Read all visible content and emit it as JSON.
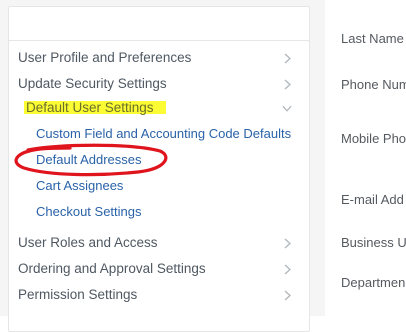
{
  "sidebar": {
    "items": [
      {
        "label": "User Profile and Preferences"
      },
      {
        "label": "Update Security Settings"
      },
      {
        "label": "Default User Settings"
      },
      {
        "label": "User Roles and Access"
      },
      {
        "label": "Ordering and Approval Settings"
      },
      {
        "label": "Permission Settings"
      }
    ],
    "sub_items": [
      {
        "label": "Custom Field and Accounting Code Defaults"
      },
      {
        "label": "Default Addresses"
      },
      {
        "label": "Cart Assignees"
      },
      {
        "label": "Checkout Settings"
      }
    ]
  },
  "form": {
    "labels": [
      {
        "label": "Last Name"
      },
      {
        "label": "Phone Num"
      },
      {
        "label": "Mobile Pho"
      },
      {
        "label": "E-mail Add"
      },
      {
        "label": "Business U"
      },
      {
        "label": "Departmen"
      }
    ]
  },
  "annotations": {
    "highlight_color": "#fbfc33",
    "circle_color": "#e0141c"
  }
}
